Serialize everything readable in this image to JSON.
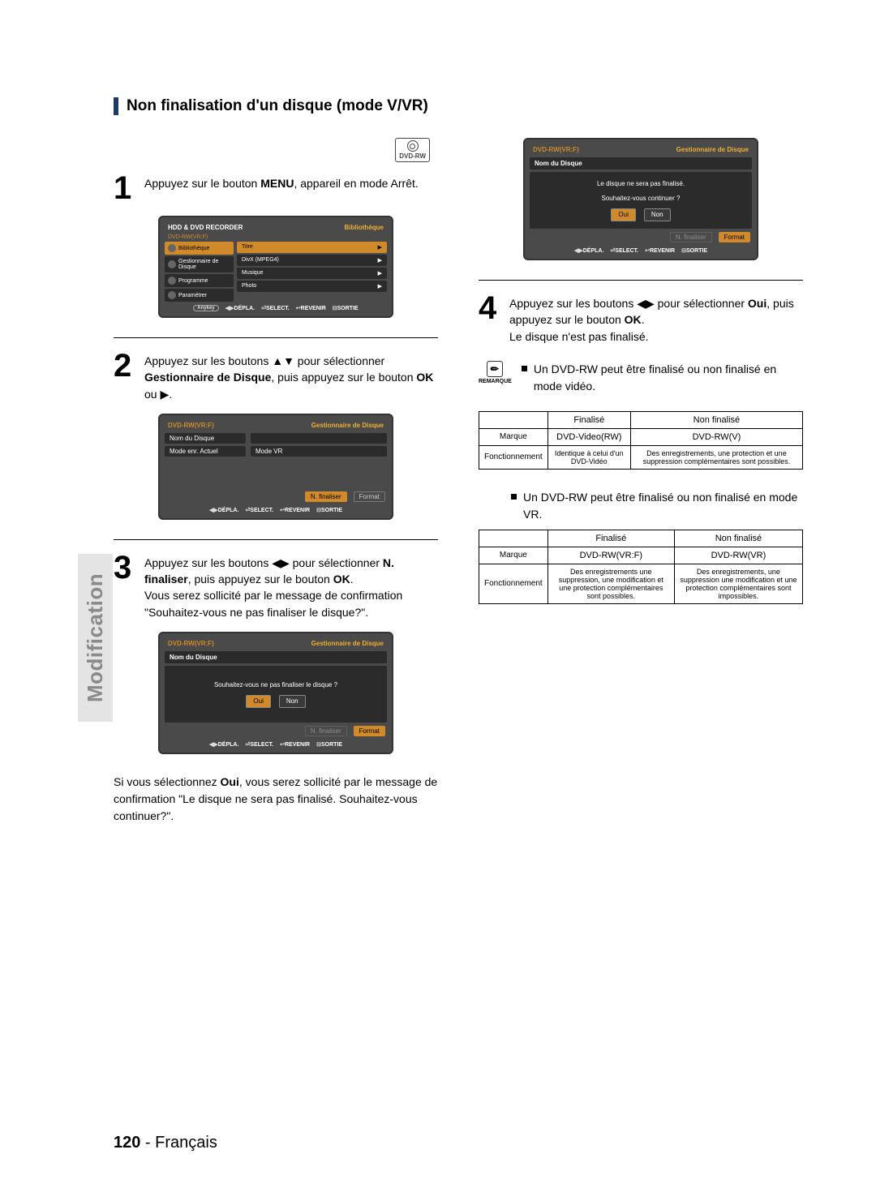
{
  "section_title": "Non finalisation d'un disque (mode V/VR)",
  "disc_badge": "DVD-RW",
  "side_tab": "Modification",
  "page_number": "120",
  "page_lang": "Français",
  "steps": {
    "1": {
      "num": "1",
      "text_a": "Appuyez sur le bouton ",
      "b1": "MENU",
      "text_b": ", appareil en mode Arrêt."
    },
    "2": {
      "num": "2",
      "text_a": "Appuyez sur les boutons ▲▼ pour sélectionner ",
      "b1": "Gestionnaire de Disque",
      "text_b": ", puis appuyez sur le bouton ",
      "b2": "OK",
      "text_c": " ou ▶."
    },
    "3": {
      "num": "3",
      "text_a": "Appuyez sur les boutons ◀▶ pour sélectionner ",
      "b1": "N. finaliser",
      "text_b": ", puis appuyez sur le bouton ",
      "b2": "OK",
      "text_c": ".",
      "text_d": "Vous serez sollicité par le message de confirmation \"Souhaitez-vous ne pas finaliser le disque?\"."
    },
    "4": {
      "num": "4",
      "text_a": "Appuyez sur les boutons ◀▶ pour sélectionner ",
      "b1": "Oui",
      "text_b": ", puis appuyez sur le bouton ",
      "b2": "OK",
      "text_c": ".",
      "text_d": "Le disque n'est pas finalisé."
    }
  },
  "para_after_3": {
    "a": "Si vous sélectionnez ",
    "b": "Oui",
    "c": ", vous serez sollicité par le message de confirmation \"Le disque ne sera pas finalisé. Souhaitez-vous continuer?\"."
  },
  "osd1": {
    "top_left": "HDD & DVD RECORDER",
    "top_right": "Bibliothèque",
    "disc": "DVD-RW(VR:F)",
    "left_items": [
      "Bibliothèque",
      "Gestionnaire de Disque",
      "Programme",
      "Paramétrer"
    ],
    "right_items": [
      "Titre",
      "DivX (MPEG4)",
      "Musique",
      "Photo"
    ],
    "footer": {
      "anykey": "Anykey",
      "depla": "DÉPLA.",
      "select": "SELECT.",
      "revenir": "REVENIR",
      "sortie": "SORTIE"
    }
  },
  "osd2": {
    "top_left": "DVD-RW(VR:F)",
    "top_right": "Gestionnaire de Disque",
    "rows": [
      {
        "k": "Nom du Disque",
        "v": ""
      },
      {
        "k": "Mode enr. Actuel",
        "v": "Mode VR"
      }
    ],
    "actions": {
      "left": "N. finaliser",
      "right": "Format"
    },
    "footer": {
      "depla": "DÉPLA.",
      "select": "SELECT.",
      "revenir": "REVENIR",
      "sortie": "SORTIE"
    }
  },
  "osd3": {
    "top_left": "DVD-RW(VR:F)",
    "top_right": "Gestionnaire de Disque",
    "label": "Nom du Disque",
    "msg": "Souhaitez-vous ne pas finaliser le disque ?",
    "oui": "Oui",
    "non": "Non",
    "actions": {
      "left": "N. finaliser",
      "right": "Format"
    },
    "footer": {
      "depla": "DÉPLA.",
      "select": "SELECT.",
      "revenir": "REVENIR",
      "sortie": "SORTIE"
    }
  },
  "osd4": {
    "top_left": "DVD-RW(VR:F)",
    "top_right": "Gestionnaire de Disque",
    "label": "Nom du Disque",
    "msg1": "Le disque ne sera pas finalisé.",
    "msg2": "Souhaitez-vous continuer ?",
    "oui": "Oui",
    "non": "Non",
    "actions": {
      "left": "N. finaliser",
      "right": "Format"
    },
    "footer": {
      "depla": "DÉPLA.",
      "select": "SELECT.",
      "revenir": "REVENIR",
      "sortie": "SORTIE"
    }
  },
  "note_label": "REMARQUE",
  "note1": "Un DVD-RW peut être finalisé ou non finalisé en mode vidéo.",
  "note2": "Un DVD-RW peut être finalisé ou non finalisé en mode VR.",
  "table1": {
    "h1": "Finalisé",
    "h2": "Non finalisé",
    "r1": "Marque",
    "r1c1": "DVD-Video(RW)",
    "r1c2": "DVD-RW(V)",
    "r2": "Fonctionnement",
    "r2c1": "Identique à celui d'un DVD-Vidéo",
    "r2c2": "Des enregistrements, une protection et une suppression complémentaires sont possibles."
  },
  "table2": {
    "h1": "Finalisé",
    "h2": "Non finalisé",
    "r1": "Marque",
    "r1c1": "DVD-RW(VR:F)",
    "r1c2": "DVD-RW(VR)",
    "r2": "Fonctionnement",
    "r2c1": "Des enregistrements une suppression, une modification et une protection complémentaires sont possibles.",
    "r2c2": "Des enregistrements, une suppression une modification et une protection complémentaires sont impossibles."
  }
}
